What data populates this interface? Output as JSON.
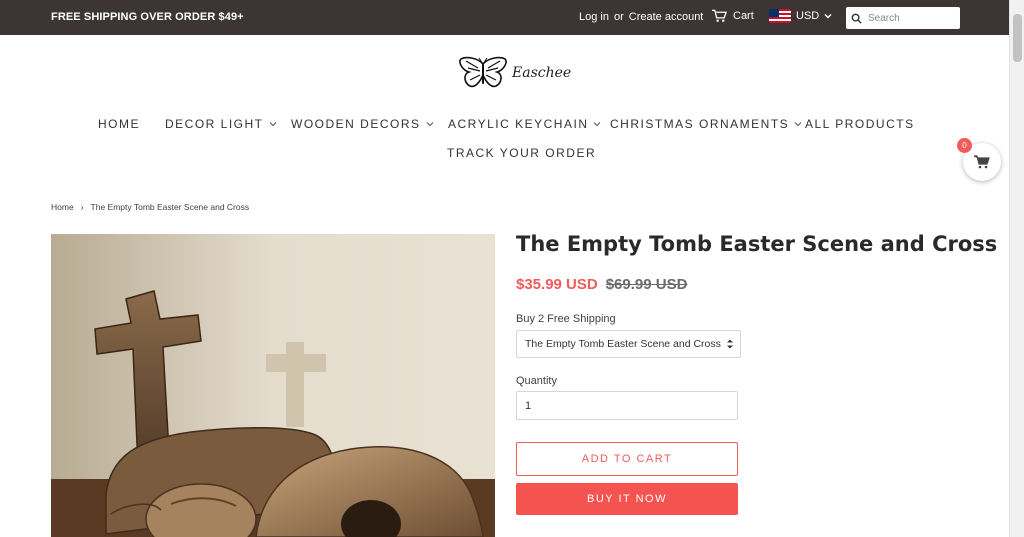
{
  "topbar": {
    "shipping_message": "FREE SHIPPING OVER ORDER $49+",
    "login": "Log in",
    "or": "or",
    "create_account": "Create account",
    "cart": "Cart",
    "currency": "USD",
    "search_placeholder": "Search"
  },
  "logo": {
    "text": "Easchee"
  },
  "nav": {
    "items": [
      {
        "label": "HOME"
      },
      {
        "label": "DECOR LIGHT"
      },
      {
        "label": "WOODEN DECORS"
      },
      {
        "label": "ACRYLIC KEYCHAIN"
      },
      {
        "label": "CHRISTMAS ORNAMENTS"
      },
      {
        "label": "ALL PRODUCTS"
      },
      {
        "label": "TRACK YOUR ORDER"
      }
    ]
  },
  "floating_cart": {
    "count": "0"
  },
  "breadcrumb": {
    "home": "Home",
    "separator": "›",
    "current": "The Empty Tomb Easter Scene and Cross"
  },
  "product": {
    "title": "The Empty Tomb Easter Scene and Cross",
    "sale_price": "$35.99 USD",
    "compare_price": "$69.99 USD",
    "variant_label": "Buy 2 Free Shipping",
    "variant_selected": "The Empty Tomb Easter Scene and Cross",
    "quantity_label": "Quantity",
    "quantity_value": "1",
    "add_to_cart": "ADD TO CART",
    "buy_now": "BUY IT NOW"
  },
  "colors": {
    "topbar_bg": "#3c3533",
    "accent": "#f15b5b",
    "buy_button": "#f5534f"
  },
  "icons": [
    "cart-icon",
    "us-flag-icon",
    "chevron-down-icon",
    "search-icon",
    "butterfly-logo-icon"
  ]
}
